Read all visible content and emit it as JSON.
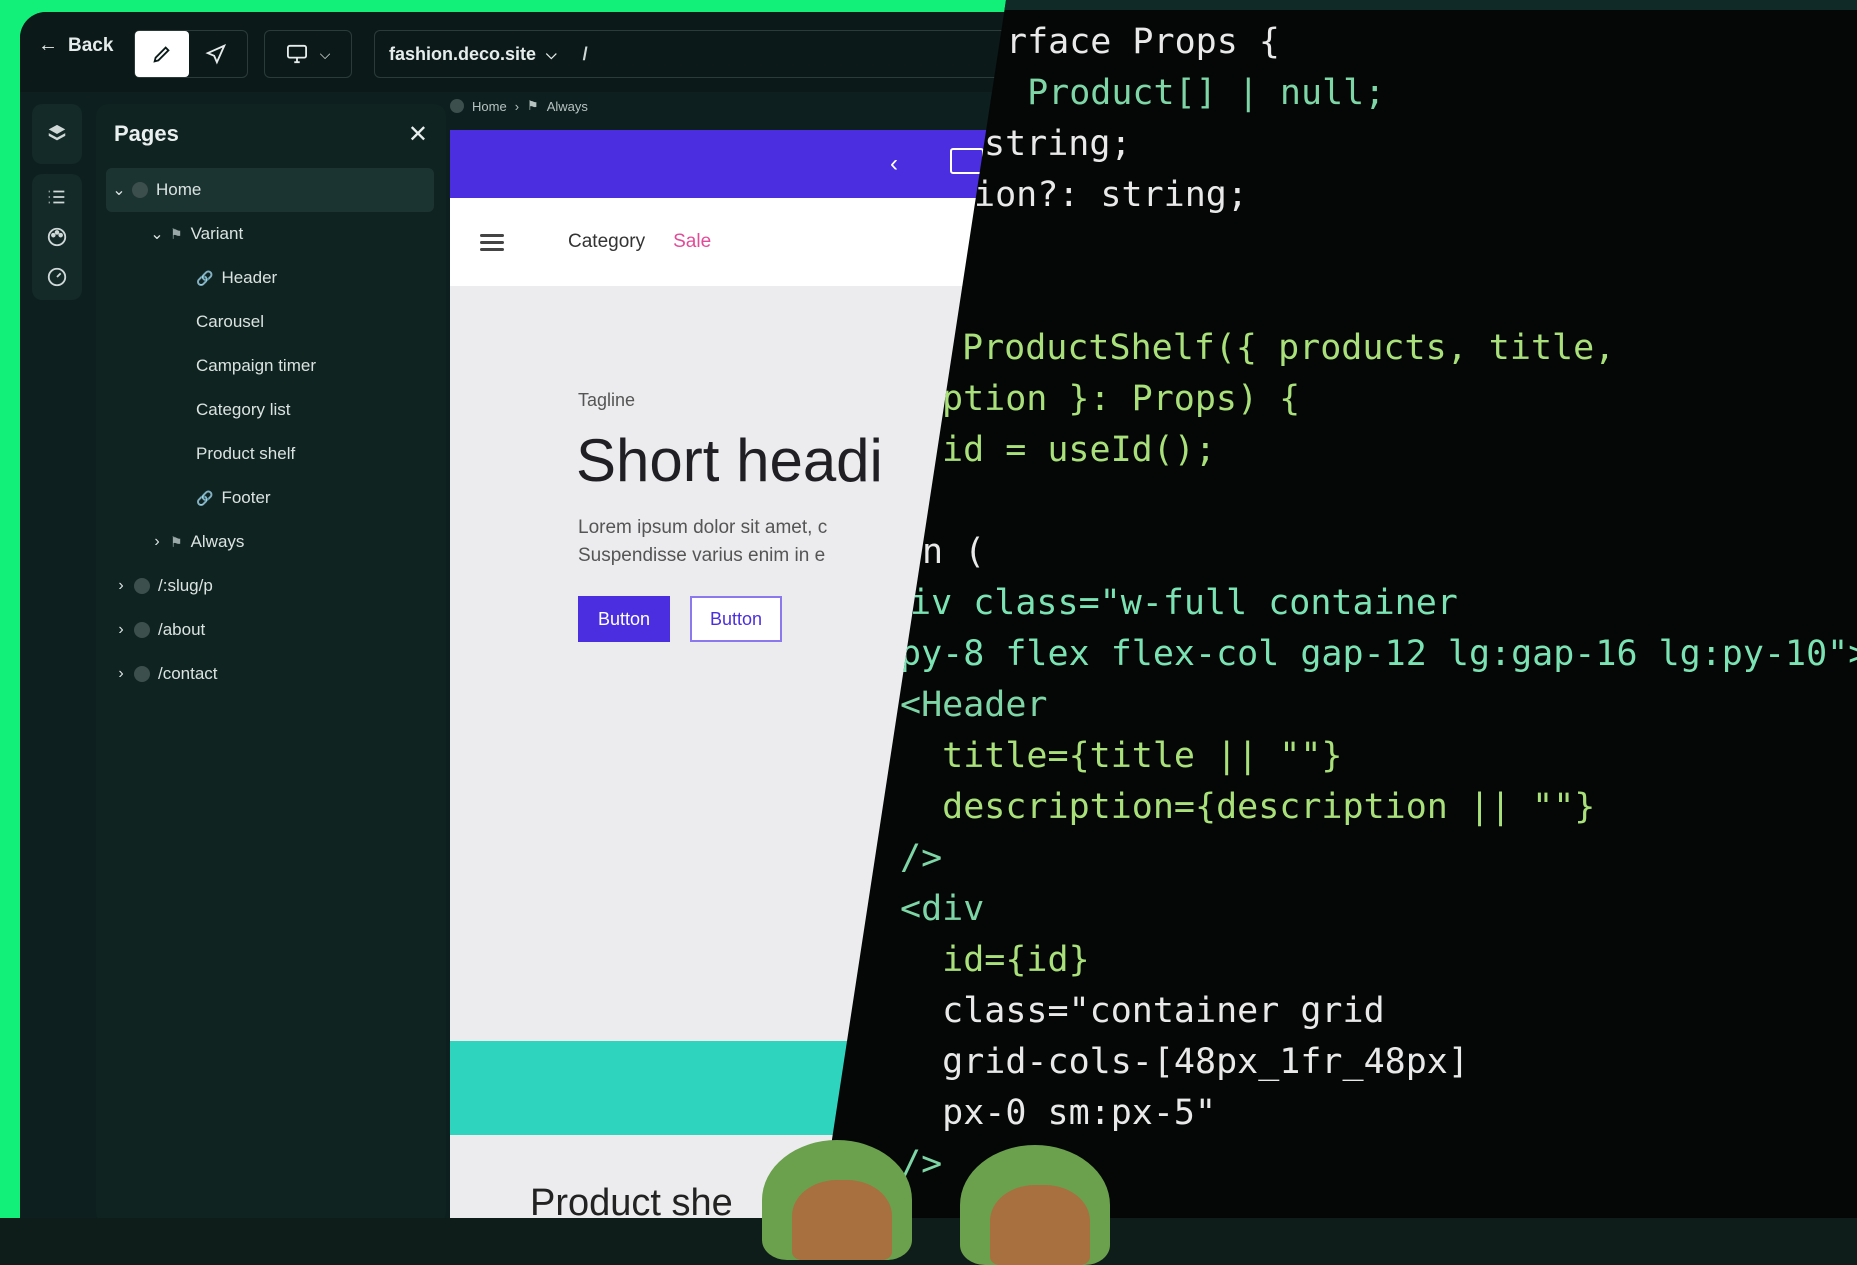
{
  "toolbar": {
    "back_label": "Back",
    "site_label": "fashion.deco.site",
    "path_label": "/"
  },
  "pages_panel": {
    "title": "Pages",
    "items": [
      {
        "label": "Home",
        "depth": 0,
        "expanded": true,
        "selected": true,
        "icon": "globe-icon"
      },
      {
        "label": "Variant",
        "depth": 1,
        "expanded": true,
        "icon": "flag-icon"
      },
      {
        "label": "Header",
        "depth": 2,
        "icon": "link-icon"
      },
      {
        "label": "Carousel",
        "depth": 2
      },
      {
        "label": "Campaign timer",
        "depth": 2
      },
      {
        "label": "Category list",
        "depth": 2
      },
      {
        "label": "Product shelf",
        "depth": 2
      },
      {
        "label": "Footer",
        "depth": 2,
        "icon": "link-icon"
      },
      {
        "label": "Always",
        "depth": 1,
        "expanded": false,
        "icon": "flag-icon"
      },
      {
        "label": "/:slug/p",
        "depth": 0,
        "expanded": false,
        "icon": "globe-icon"
      },
      {
        "label": "/about",
        "depth": 0,
        "expanded": false,
        "icon": "globe-icon"
      },
      {
        "label": "/contact",
        "depth": 0,
        "expanded": false,
        "icon": "globe-icon"
      }
    ]
  },
  "breadcrumb": {
    "home": "Home",
    "always": "Always"
  },
  "preview": {
    "nav_category": "Category",
    "nav_sale": "Sale",
    "tagline": "Tagline",
    "headline": "Short headi",
    "lorem_line1": "Lorem ipsum dolor sit amet, c",
    "lorem_line2": "Suspendisse varius enim in e",
    "button_primary": "Button",
    "button_secondary": "Button",
    "shelf_title": "Product she"
  },
  "code": {
    "lines": [
      "rface Props {",
      " Product[] | null;",
      "string;",
      "ion?: string;",
      "ProductShelf({ products, title,",
      "ption }: Props) {",
      "id = useId();",
      "n (",
      "iv class=\"w-full container",
      "py-8 flex flex-col gap-12 lg:gap-16 lg:py-10\">",
      "<Header",
      "  title={title || \"\"}",
      "  description={description || \"\"}",
      "/>",
      "<div",
      "  id={id}",
      "  class=\"container grid",
      "  grid-cols-[48px_1fr_48px]",
      "  px-0 sm:px-5\"",
      "/>"
    ]
  },
  "colors": {
    "frame_green": "#12f07a",
    "app_bg": "#0d1f1e",
    "brand_purple": "#4b2ee0",
    "sale_pink": "#e24b98",
    "teal_band": "#2fd4bf",
    "code_bg": "#050707"
  }
}
